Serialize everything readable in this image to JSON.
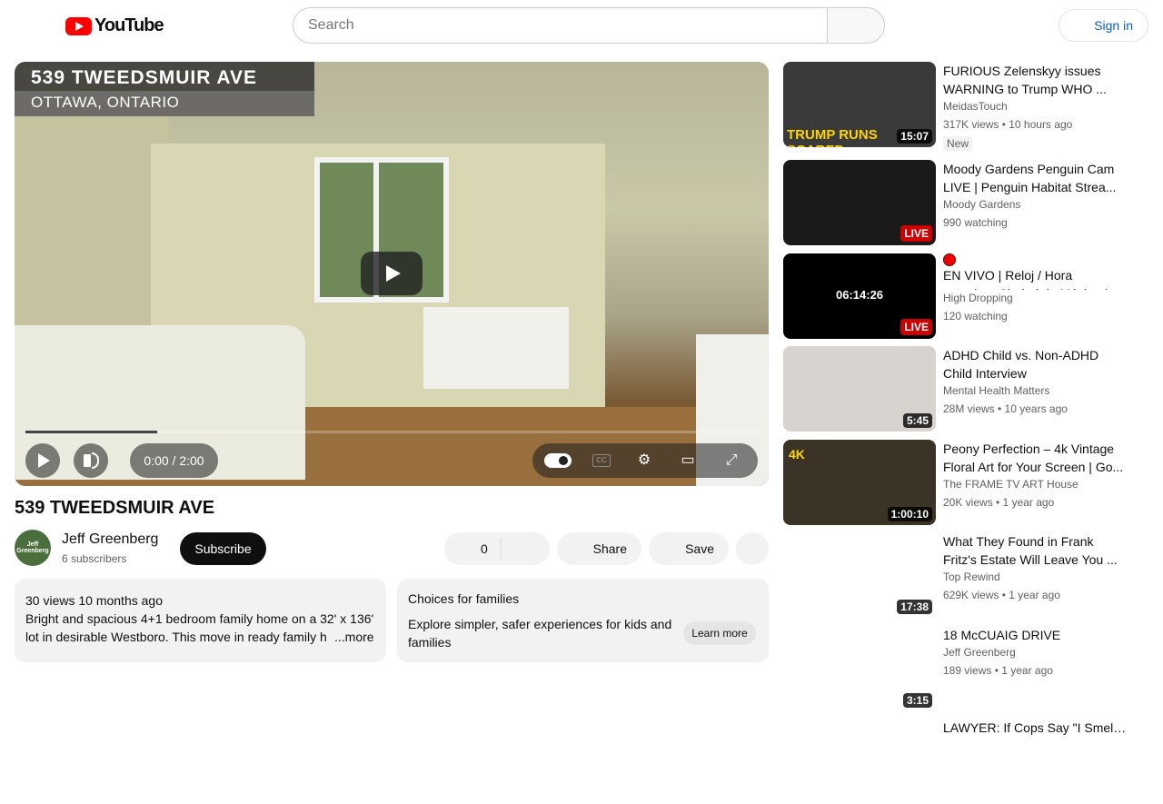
{
  "header": {
    "logo_text": "YouTube",
    "search_placeholder": "Search",
    "signin_label": "Sign in"
  },
  "player": {
    "overlay_title": "539 TWEEDSMUIR AVE",
    "overlay_subtitle": "OTTAWA, ONTARIO",
    "time": "0:00 / 2:00",
    "progress_fraction": 0.18,
    "cc_label": "CC"
  },
  "video": {
    "title": "539 TWEEDSMUIR AVE",
    "channel": "Jeff Greenberg",
    "subscribers": "6 subscribers",
    "avatar_text": "Jeff Greenberg",
    "subscribe_label": "Subscribe",
    "likes": "0",
    "share_label": "Share",
    "save_label": "Save"
  },
  "description": {
    "meta": "30 views  10 months ago",
    "text": "Bright and spacious 4+1 bedroom family home on a 32' x 136' lot in desirable Westboro. This move in ready family h",
    "more_label": "...more"
  },
  "families": {
    "title": "Choices for families",
    "text": "Explore simpler, safer experiences for kids and families",
    "learn_label": "Learn more"
  },
  "recommendations": [
    {
      "title_line1": "FURIOUS Zelenskyy issues",
      "title_line2": "WARNING to Trump WHO ...",
      "channel": "MeidasTouch",
      "meta": "317K views • 10 hours ago",
      "badge": "New",
      "duration": "15:07",
      "thumb_text": "TRUMP RUNS SCARED",
      "thumb_color": "#3a3a3a"
    },
    {
      "title_line1": "Moody Gardens Penguin Cam",
      "title_line2": "LIVE | Penguin Habitat Strea...",
      "channel": "Moody Gardens",
      "meta": "990 watching",
      "live": "LIVE",
      "thumb_color": "#1a1a1a"
    },
    {
      "title_line1": "EN VIVO | Reloj / Hora",
      "title_line2": "actual en Ciudad de México / ...",
      "channel": "High Dropping",
      "meta": "120 watching",
      "live": "LIVE",
      "thumb_text": "06:14:26",
      "thumb_color": "#000000"
    },
    {
      "title_line1": "ADHD Child vs. Non-ADHD",
      "title_line2": "Child Interview",
      "channel": "Mental Health Matters",
      "meta": "28M views • 10 years ago",
      "duration": "5:45",
      "thumb_color": "#d7d4cf"
    },
    {
      "title_line1": "Peony Perfection – 4k Vintage",
      "title_line2": "Floral Art for Your Screen | Go...",
      "channel": "The FRAME TV ART House",
      "meta": "20K views • 1 year ago",
      "duration": "1:00:10",
      "thumb_text": "4K",
      "thumb_color": "#3b3325"
    },
    {
      "title_line1": "What They Found in Frank",
      "title_line2": "Fritz's Estate Will Leave You ...",
      "channel": "Top Rewind",
      "meta": "629K views • 1 year ago",
      "duration": "17:38",
      "thumb_color": "#ffffff"
    },
    {
      "title_line1": "18 McCUAIG DRIVE",
      "title_line2": "",
      "channel": "Jeff Greenberg",
      "meta": "189 views • 1 year ago",
      "duration": "3:15",
      "thumb_color": "#ffffff"
    },
    {
      "title_line1": "LAWYER: If Cops Say \"I Smell...",
      "title_line2": "",
      "channel": "",
      "meta": "",
      "thumb_color": "#ffffff"
    }
  ]
}
